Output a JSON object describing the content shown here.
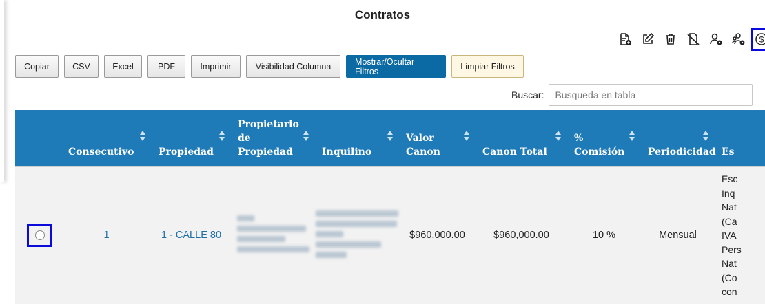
{
  "page": {
    "title": "Contratos"
  },
  "toolbar_icons": [
    {
      "name": "add-document-icon"
    },
    {
      "name": "edit-icon"
    },
    {
      "name": "trash-icon"
    },
    {
      "name": "no-document-icon"
    },
    {
      "name": "user-settings-icon"
    },
    {
      "name": "user-group-settings-icon"
    },
    {
      "name": "dollar-circle-icon"
    }
  ],
  "buttons": {
    "copy": "Copiar",
    "csv": "CSV",
    "excel": "Excel",
    "pdf": "PDF",
    "print": "Imprimir",
    "col_visibility": "Visibilidad Columna",
    "toggle_filters": "Mostrar/Ocultar Filtros",
    "clear_filters": "Limpiar Filtros"
  },
  "search": {
    "label": "Buscar:",
    "placeholder": "Busqueda en tabla",
    "value": ""
  },
  "table": {
    "columns": {
      "consecutivo": "Consecutivo",
      "propiedad": "Propiedad",
      "propietario": "Propietario de Propiedad",
      "inquilino": "Inquilino",
      "valor_canon": "Valor Canon",
      "canon_total": "Canon Total",
      "comision": "% Comisión",
      "periodicidad": "Periodicidad",
      "estado": "Es"
    },
    "rows": [
      {
        "consecutivo": "1",
        "propiedad": "1 - CALLE 80",
        "valor_canon": "$960,000.00",
        "canon_total": "$960,000.00",
        "comision": "10 %",
        "periodicidad": "Mensual",
        "estado_lines": [
          "Esc",
          "Inq",
          "Nat",
          "(Ca",
          "IVA",
          "Pers",
          "Nat",
          "(Co",
          "con"
        ]
      }
    ]
  }
}
